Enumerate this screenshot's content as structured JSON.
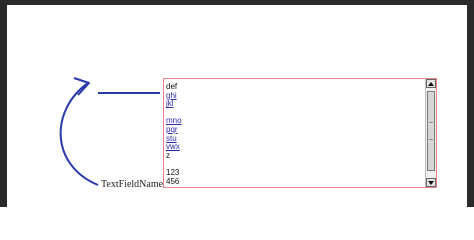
{
  "annotation": {
    "field_name_label": "TextFieldName",
    "arrow_color": "#2a3aa8"
  },
  "text_field": {
    "border_color": "#e8838f",
    "lines": [
      {
        "text": "def",
        "link": false
      },
      {
        "text": "ghi",
        "link": true
      },
      {
        "text": "jkl",
        "link": true
      },
      {
        "text": "",
        "link": false
      },
      {
        "text": "mno",
        "link": true
      },
      {
        "text": "pqr",
        "link": true
      },
      {
        "text": "stu",
        "link": true
      },
      {
        "text": "vwx",
        "link": true
      },
      {
        "text": "z",
        "link": false
      },
      {
        "text": "",
        "link": false
      },
      {
        "text": "123",
        "link": false
      },
      {
        "text": "456",
        "link": false
      }
    ]
  },
  "scrollbar": {
    "up_icon": "arrow-up-icon",
    "down_icon": "arrow-down-icon",
    "scroll_position": 0.5
  }
}
